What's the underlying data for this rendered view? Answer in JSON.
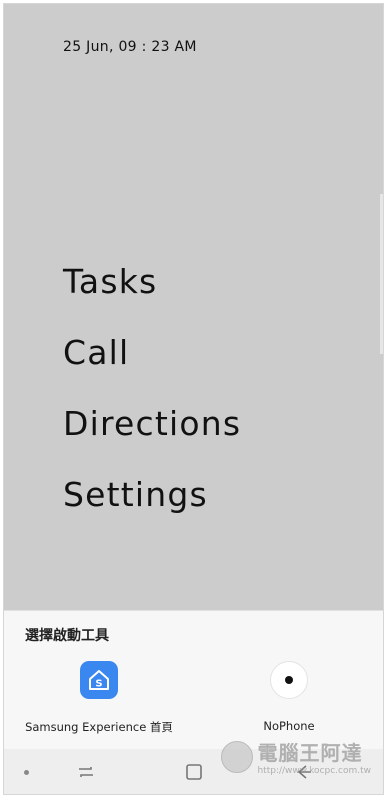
{
  "status": {
    "datetime": "25 Jun, 09 : 23 AM"
  },
  "menu": {
    "items": [
      {
        "label": "Tasks"
      },
      {
        "label": "Call"
      },
      {
        "label": "Directions"
      },
      {
        "label": "Settings"
      }
    ]
  },
  "chooser": {
    "title": "選擇啟動工具",
    "apps": [
      {
        "label": "Samsung Experience 首頁",
        "icon": "samsung-home-icon",
        "color": "#3b87f0"
      },
      {
        "label": "NoPhone",
        "icon": "nophone-icon"
      }
    ]
  },
  "navbar": {
    "buttons": [
      "dot-icon",
      "recents-icon",
      "home-icon",
      "back-icon"
    ]
  },
  "watermark": {
    "title": "電腦王阿達",
    "url": "http://www.kocpc.com.tw"
  }
}
